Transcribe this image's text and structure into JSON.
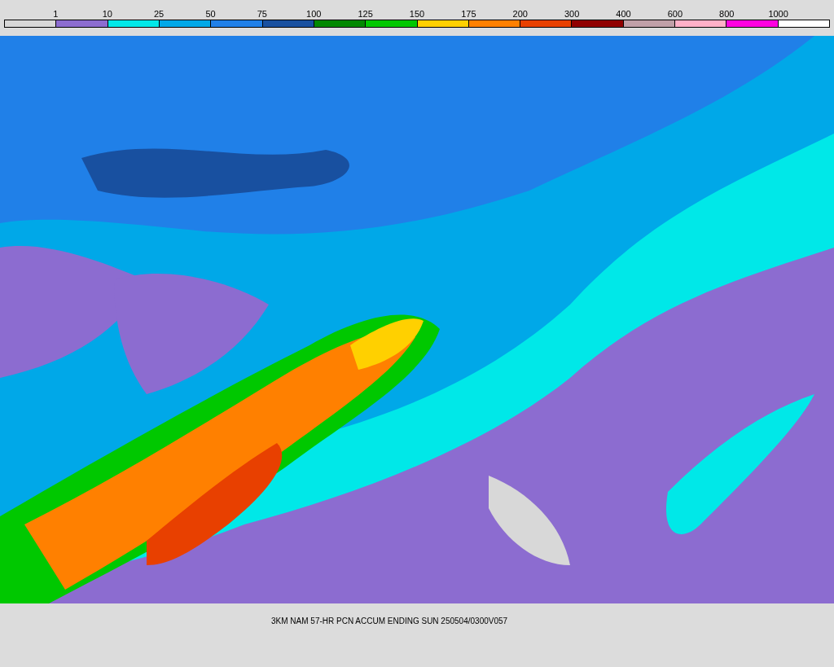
{
  "legend": {
    "segments": [
      {
        "color": "#d8d8d8"
      },
      {
        "color": "#8c6cd0"
      },
      {
        "color": "#00e8e8"
      },
      {
        "color": "#00a8e8"
      },
      {
        "color": "#2080e8"
      },
      {
        "color": "#1850a0"
      },
      {
        "color": "#008800"
      },
      {
        "color": "#00c800"
      },
      {
        "color": "#ffd000"
      },
      {
        "color": "#ff8000"
      },
      {
        "color": "#e84000"
      },
      {
        "color": "#900000"
      },
      {
        "color": "#c0a0a8"
      },
      {
        "color": "#ffb0c8"
      },
      {
        "color": "#ff00e0"
      },
      {
        "color": "#ffffff"
      }
    ],
    "labels": [
      "1",
      "10",
      "25",
      "50",
      "75",
      "100",
      "125",
      "150",
      "175",
      "200",
      "300",
      "400",
      "600",
      "800",
      "1000"
    ]
  },
  "caption": "3KM NAM 57-HR PCN ACCUM ENDING SUN 250504/0300V057"
}
